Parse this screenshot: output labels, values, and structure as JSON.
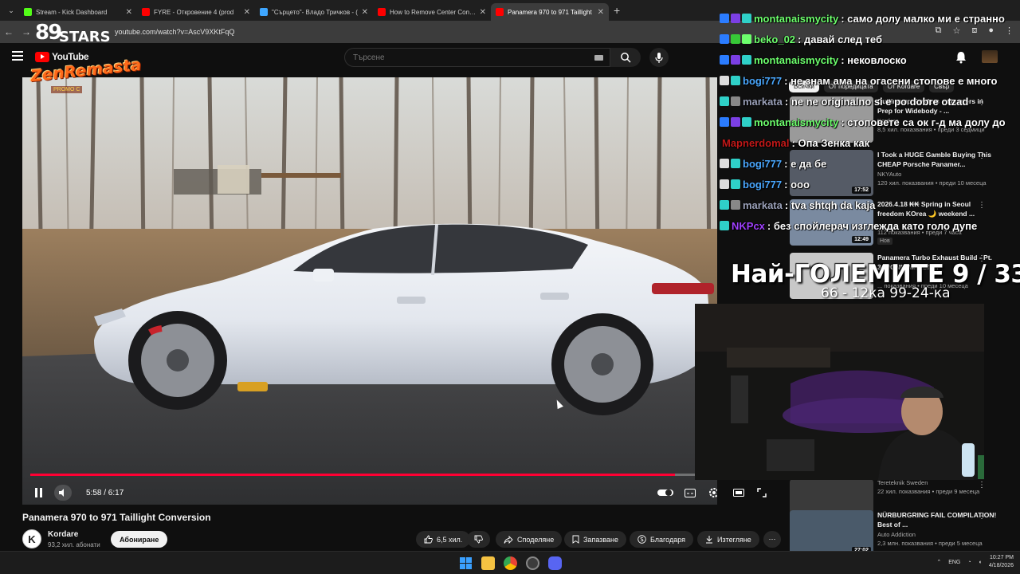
{
  "browser": {
    "tabs": [
      {
        "title": "Stream - Kick Dashboard",
        "color": "#53fc18",
        "active": false
      },
      {
        "title": "FYRE - Откровение 4 (prod",
        "color": "#ff0000",
        "active": false
      },
      {
        "title": "\"Сърцето\"- Владо Тричков - (",
        "color": "#3ea6ff",
        "active": false
      },
      {
        "title": "How to Remove Center Console",
        "color": "#ff0000",
        "active": false
      },
      {
        "title": "Panamera 970 to 971 Taillight",
        "color": "#ff0000",
        "active": true
      }
    ],
    "url": "youtube.com/watch?v=AscV9XKtFqQ"
  },
  "youtube": {
    "logo_text": "YouTube",
    "search_placeholder": "Търсене"
  },
  "overlays": {
    "stars_num": "89",
    "stars_word": "STARS",
    "zen_text": "ZenRemasta",
    "zen_promo": "PROMO C"
  },
  "player": {
    "time": "5:58 / 6:17",
    "progress": 0.949
  },
  "video": {
    "title": "Panamera 970 to 971 Taillight Conversion",
    "channel": "Kordare",
    "channel_initial": "K",
    "subscribers": "93,2 хил. абонати",
    "subscribe_label": "Абониране",
    "likes": "6,5 хил.",
    "share_label": "Споделяне",
    "save_label": "Запазване",
    "thanks_label": "Благодаря",
    "download_label": "Изтегляне"
  },
  "sidebar": {
    "chips": [
      "Всички",
      "От поредицата",
      "От Kordare",
      "Свър"
    ],
    "recommendations": [
      {
        "title": "Cutting up Fenders + Quarters in Prep for Widebody - ...",
        "channel": "Kordare",
        "meta": "8,5 хил. показвания • преди 3 седмици",
        "duration": "",
        "badge": "",
        "thumb": "#9a9a9a"
      },
      {
        "title": "I Took a HUGE Gamble Buying This CHEAP Porsche Panamer...",
        "channel": "NKYAuto",
        "meta": "120 хил. показвания • преди 10 месеца",
        "duration": "17:52",
        "badge": "",
        "thumb": "#555b66"
      },
      {
        "title": "2026.4.18 ₭₭ Spring in Seoul freedom KOrea 🌙 weekend ...",
        "channel": "",
        "meta": "112 показвания • преди 7 часа",
        "duration": "12:49",
        "badge": "Нов",
        "thumb": "#7a8aa0"
      },
      {
        "title": "Panamera Turbo Exhaust Build - Pt. 3: DONE AMAZIN...",
        "channel": "",
        "meta": "... показвания • преди 10 месеца",
        "duration": "",
        "badge": "",
        "thumb": "#c8c8c8"
      },
      {
        "title": "",
        "channel": "Tereteknik Sweden",
        "meta": "22 хил. показвания • преди 9 месеца",
        "duration": "13:12",
        "badge": "",
        "thumb": "#3a3a3a"
      },
      {
        "title": "NÜRBURGRING FAIL COMPILATION! Best of ...",
        "channel": "Auto Addiction",
        "meta": "2,3 млн. показвания • преди 5 месеца",
        "duration": "27:02",
        "badge": "",
        "thumb": "#4a5a6a"
      }
    ]
  },
  "chat": [
    {
      "user": "montanaismycity",
      "text": ": само долу малко ми е странно",
      "color": "#6dff6d",
      "badges": [
        "#2b7cff",
        "#7b3fe4",
        "#2fd0c8"
      ]
    },
    {
      "user": "beko_02",
      "text": ": давай след теб",
      "color": "#6dff6d",
      "badges": [
        "#2b7cff",
        "#37c837",
        "#6dff6d"
      ]
    },
    {
      "user": "montanaismycity",
      "text": ": нековлоско",
      "color": "#6dff6d",
      "badges": [
        "#2b7cff",
        "#7b3fe4",
        "#2fd0c8"
      ]
    },
    {
      "user": "bogi777",
      "text": ": не знам ама на огасени стопове е много",
      "color": "#4aa8ff",
      "badges": [
        "#dddddd",
        "#2fd0c8"
      ]
    },
    {
      "user": "markata",
      "text": ": ne ne originalno si e po dobre otzad",
      "color": "#9aa0b8",
      "badges": [
        "#2fd0c8",
        "#888888"
      ]
    },
    {
      "user": "montanaismycity",
      "text": ": стоповете са ок г-д ма долу до",
      "color": "#6dff6d",
      "badges": [
        "#2b7cff",
        "#7b3fe4",
        "#2fd0c8"
      ]
    },
    {
      "user": "Mapnerdomal",
      "text": ": Опа Зенка как",
      "color": "#c01818",
      "badges": []
    },
    {
      "user": "bogi777",
      "text": ": е да бе",
      "color": "#4aa8ff",
      "badges": [
        "#dddddd",
        "#2fd0c8"
      ]
    },
    {
      "user": "bogi777",
      "text": ": ооо",
      "color": "#4aa8ff",
      "badges": [
        "#dddddd",
        "#2fd0c8"
      ]
    },
    {
      "user": "markata",
      "text": ": tva shtqh da kaja",
      "color": "#9aa0b8",
      "badges": [
        "#2fd0c8",
        "#888888"
      ]
    },
    {
      "user": "NKPcx",
      "text": ": без спойлерач изглежда като голо дупе",
      "color": "#a040ff",
      "badges": [
        "#2fd0c8"
      ]
    }
  ],
  "widget": {
    "title": "Най-ГОЛЕМИТЕ 9 / 33",
    "subtitle": "66 - 12ка 99-24-ка"
  },
  "taskbar": {
    "lang": "ENG",
    "time": "10:27 PM",
    "date": "4/18/2026"
  }
}
